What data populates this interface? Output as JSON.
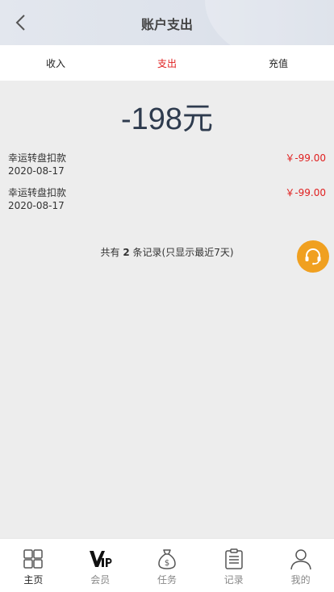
{
  "header": {
    "title": "账户支出",
    "back_icon": "chevron-left-icon"
  },
  "tabs": [
    {
      "label": "收入",
      "active": false
    },
    {
      "label": "支出",
      "active": true
    },
    {
      "label": "充值",
      "active": false
    }
  ],
  "total": "-198元",
  "records": [
    {
      "title": "幸运转盘扣款",
      "date": "2020-08-17",
      "amount": "￥-99.00"
    },
    {
      "title": "幸运转盘扣款",
      "date": "2020-08-17",
      "amount": "￥-99.00"
    }
  ],
  "summary": {
    "prefix": "共有",
    "count": "2",
    "suffix": "条记录(只显示最近7天)"
  },
  "customer_service": {
    "icon": "headset-icon",
    "color": "#f0a020"
  },
  "tabbar": [
    {
      "label": "主页",
      "icon": "grid-icon",
      "active": true
    },
    {
      "label": "会员",
      "icon": "vip-icon",
      "active": false
    },
    {
      "label": "任务",
      "icon": "money-bag-icon",
      "active": false
    },
    {
      "label": "记录",
      "icon": "clipboard-icon",
      "active": false
    },
    {
      "label": "我的",
      "icon": "user-icon",
      "active": false
    }
  ],
  "colors": {
    "accent_red": "#e02020",
    "amount_dark": "#2e3b4e",
    "background": "#ededed"
  }
}
